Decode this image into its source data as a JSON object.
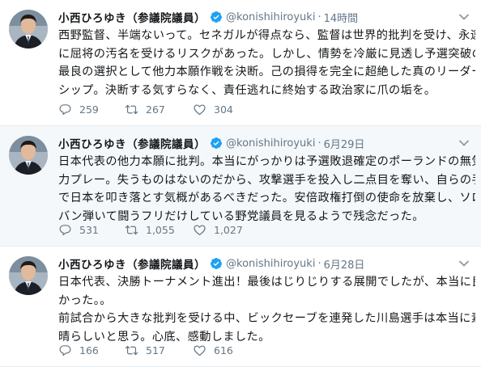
{
  "tweets": [
    {
      "name": "小西ひろゆき（参議院議員）",
      "handle": "@konishihiroyuki",
      "separator": "·",
      "time": "14時間",
      "lines": [
        "西野監督、半端ないって。セネガルが得点なら、監督は世界的批判を受け、永遠",
        "に屈将の汚名を受けるリスクがあった。しかし、情勢を冷厳に見透し予選突破の",
        "最良の選択として他力本願作戦を決断。己の損得を完全に超絶した真のリーダー",
        "シップ。決断する気すらなく、責任逃れに終始する政治家に爪の垢を。"
      ],
      "replies": "259",
      "retweets": "267",
      "likes": "304"
    },
    {
      "name": "小西ひろゆき（参議院議員）",
      "handle": "@konishihiroyuki",
      "separator": "·",
      "time": "6月29日",
      "lines": [
        "日本代表の他力本願に批判。本当にがっかりは予選敗退確定のポーランドの無気",
        "力プレー。失うものはないのだから、攻撃選手を投入し二点目を奪い、自らの手",
        "で日本を叩き落とす気概があるべきだった。安倍政権打倒の使命を放棄し、ソロ",
        "バン弾いて闘うフリだけしている野党議員を見るようで残念だった。"
      ],
      "replies": "531",
      "retweets": "1,055",
      "likes": "1,027"
    },
    {
      "name": "小西ひろゆき（参議院議員）",
      "handle": "@konishihiroyuki",
      "separator": "·",
      "time": "6月28日",
      "lines": [
        "日本代表、決勝トーナメント進出！最後はじりじりする展開でしたが、本当に良",
        "かった。。",
        "前試合から大きな批判を受ける中、ビックセーブを連発した川島選手は本当に素",
        "晴らしいと思う。心底、感動しました。"
      ],
      "replies": "166",
      "retweets": "517",
      "likes": "616"
    }
  ],
  "colors": {
    "name": "#14171a",
    "meta": "#657786",
    "verified": "#1da1f2",
    "highlight_bg": "#f5f8fa",
    "divider": "#e6ecf0"
  },
  "icons": {
    "avatar": "avatar",
    "verified": "verified-badge-icon",
    "more": "chevron-down-icon",
    "reply": "reply-icon",
    "retweet": "retweet-icon",
    "like": "heart-icon"
  }
}
